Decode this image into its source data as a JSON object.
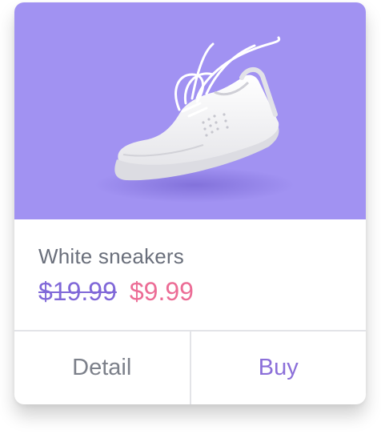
{
  "product": {
    "name": "White sneakers",
    "original_price": "$19.99",
    "sale_price": "$9.99",
    "image_subject": "white-sneaker"
  },
  "actions": {
    "detail_label": "Detail",
    "buy_label": "Buy"
  },
  "colors": {
    "hero_background": "#a192f2",
    "original_price": "#8068d8",
    "sale_price": "#ec6d96",
    "buy_label": "#8b6fd9",
    "detail_label": "#7c808a"
  }
}
